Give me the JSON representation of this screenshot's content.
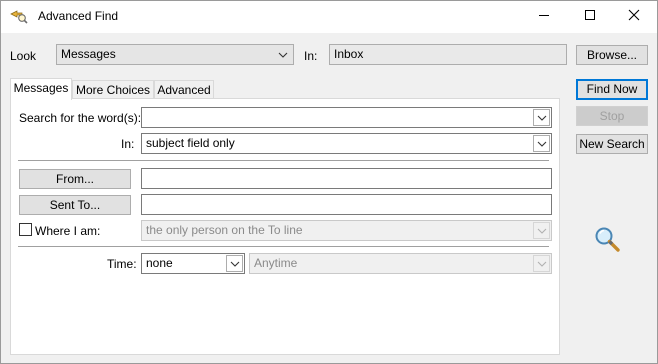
{
  "window": {
    "title": "Advanced Find",
    "icon": "advanced-find-icon",
    "controls": {
      "minimize": "minimize-icon",
      "maximize": "maximize-icon",
      "close": "close-icon"
    }
  },
  "top": {
    "look_label": "Look",
    "look_value": "Messages",
    "in_label": "In:",
    "in_value": "Inbox",
    "browse_label": "Browse..."
  },
  "tabs": [
    {
      "label": "Messages",
      "active": true
    },
    {
      "label": "More Choices",
      "active": false
    },
    {
      "label": "Advanced",
      "active": false
    }
  ],
  "messages": {
    "search_label": "Search for the word(s):",
    "search_value": "",
    "in_label": "In:",
    "in_value": "subject field only",
    "from_button": "From...",
    "from_value": "",
    "sent_to_button": "Sent To...",
    "sent_to_value": "",
    "where_label": "Where I am:",
    "where_checked": false,
    "where_value": "the only person on the To line",
    "time_label": "Time:",
    "time_value": "none",
    "time_range_value": "Anytime"
  },
  "actions": {
    "find_now": "Find Now",
    "stop": "Stop",
    "new_search": "New Search"
  },
  "decor": {
    "search_icon": "magnifier-icon"
  },
  "colors": {
    "accent": "#0078d7"
  }
}
